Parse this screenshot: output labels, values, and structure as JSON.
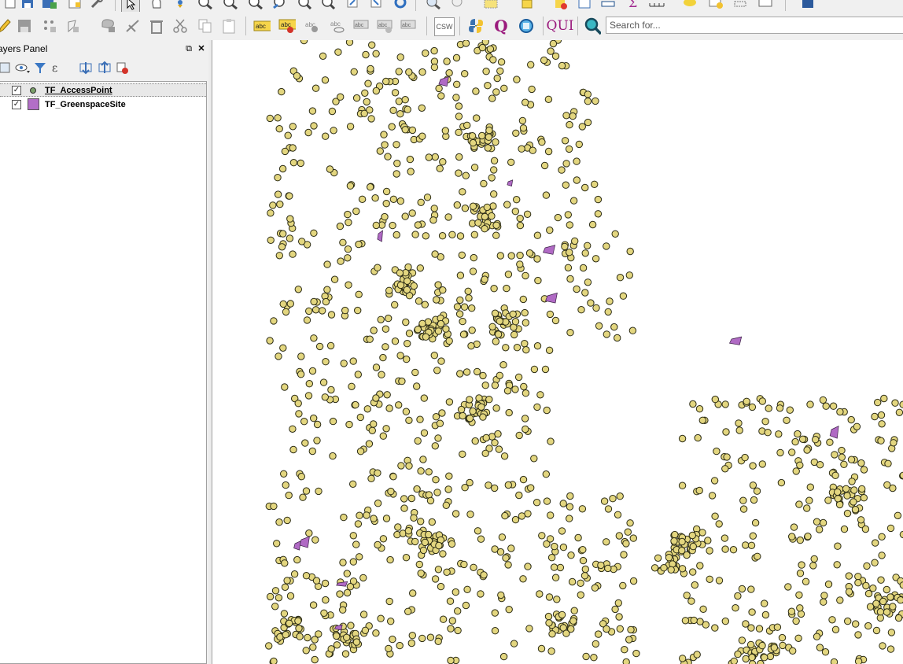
{
  "search": {
    "placeholder": "Search for..."
  },
  "toolbar_top": {
    "icons": [
      "new-project-icon",
      "save-project-icon",
      "save-as-icon",
      "layout-icon",
      "wrench-icon",
      "select-arrow-icon",
      "hand-pan-icon",
      "pan-map-icon",
      "zoom-in-icon",
      "zoom-out-icon",
      "zoom-full-icon",
      "zoom-layer-icon",
      "zoom-last-icon",
      "zoom-next-icon",
      "refresh-icon",
      "identify-icon",
      "select-features-icon",
      "deselect-icon",
      "open-table-icon",
      "statistics-icon",
      "measure-icon",
      "ruler-icon",
      "tooltip-icon",
      "bookmark-icon",
      "annotation-icon",
      "help-icon"
    ]
  },
  "toolbar_bottom": {
    "icons": [
      "pencil-edit-icon",
      "save-edits-icon",
      "digitize-point-icon",
      "digitize-polygon-icon",
      "move-feature-icon",
      "vertex-tool-icon",
      "delete-selected-icon",
      "cut-features-icon",
      "copy-features-icon",
      "paste-features-icon",
      "label-icon",
      "label-highlight-icon",
      "label-pin-icon",
      "label-show-icon",
      "label-move-icon",
      "label-rotate-icon",
      "label-change-icon",
      "csw-icon",
      "python-icon",
      "qgis-q-icon",
      "zoom-select-icon",
      "qui-icon",
      "locator-search-icon"
    ],
    "csw_label": "CSW",
    "q_label": "Q",
    "qui_label": "QUI"
  },
  "layers_panel": {
    "title": "ayers Panel",
    "float_symbol": "⧉",
    "close_symbol": "✕",
    "tools": [
      "open-style-panel-icon",
      "visibility-eye-icon",
      "filter-icon",
      "expression-filter-icon",
      "expand-all-icon",
      "collapse-all-icon",
      "remove-layer-icon"
    ],
    "layers": [
      {
        "name": "TF_AccessPoint",
        "checked": true,
        "symbol": "point",
        "color": "#7ba06a",
        "selected": true
      },
      {
        "name": "TF_GreenspaceSite",
        "checked": true,
        "symbol": "polygon",
        "color": "#b26ec7",
        "selected": false
      }
    ],
    "check_mark": "✓"
  },
  "map": {
    "point_fill": "#e3d67f",
    "point_stroke": "#2a2a14",
    "polygon_fill": "#b06ac4"
  }
}
